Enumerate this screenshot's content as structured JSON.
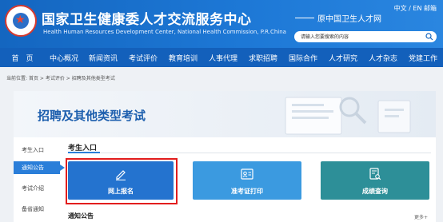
{
  "header": {
    "title": "国家卫生健康委人才交流服务中心",
    "subtitle": "Health Human Resources Development Center, National Health Commission, P.R.China",
    "former_name": "原中国卫生人才网",
    "lang_zh": "中文",
    "lang_sep": "/",
    "lang_en": "EN",
    "mail": "邮箱",
    "search_placeholder": "请输入您要搜索的内容"
  },
  "nav": {
    "items": [
      "首　页",
      "中心概况",
      "新闻资讯",
      "考试评价",
      "教育培训",
      "人事代理",
      "求职招聘",
      "国际合作",
      "人才研究",
      "人才杂志",
      "党建工作"
    ]
  },
  "breadcrumb": {
    "label": "当前位置:",
    "items": [
      "首页",
      "考试评价",
      "招聘及其他类型考试"
    ],
    "sep": ">"
  },
  "banner": {
    "title": "招聘及其他类型考试"
  },
  "sidebar": {
    "items": [
      {
        "label": "考生入口",
        "active": false
      },
      {
        "label": "通知公告",
        "active": true
      },
      {
        "label": "考试介绍",
        "active": false
      },
      {
        "label": "备省通知",
        "active": false
      }
    ]
  },
  "main": {
    "section_title": "考生入口",
    "cards": [
      {
        "label": "网上报名",
        "icon": "edit-icon",
        "color": "#2473cf"
      },
      {
        "label": "准考证打印",
        "icon": "id-card-icon",
        "color": "#3b9ae0"
      },
      {
        "label": "成绩查询",
        "icon": "document-search-icon",
        "color": "#2d8f98"
      }
    ],
    "notice_title": "通知公告",
    "more": "更多+"
  },
  "colors": {
    "header_blue": "#1466c0",
    "nav_blue": "#1360bb",
    "accent": "#2a7ed9",
    "highlight": "#e21d1d"
  }
}
